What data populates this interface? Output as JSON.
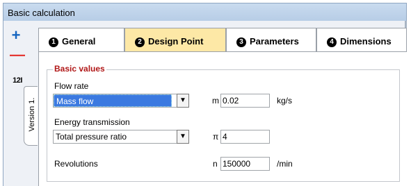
{
  "window": {
    "title": "Basic calculation"
  },
  "toolbar": {
    "add_icon": "plus-icon",
    "add_glyph": "+",
    "remove_icon": "minus-icon",
    "remove_glyph": "—",
    "numbering_label": "12I"
  },
  "version_tab": {
    "label": "Version 1."
  },
  "tabs": [
    {
      "number": "1",
      "label": "General",
      "active": false
    },
    {
      "number": "2",
      "label": "Design Point",
      "active": true
    },
    {
      "number": "3",
      "label": "Parameters",
      "active": false
    },
    {
      "number": "4",
      "label": "Dimensions",
      "active": false
    }
  ],
  "group": {
    "legend": "Basic values"
  },
  "flow": {
    "label": "Flow rate",
    "selected": "Mass flow",
    "symbol": "m",
    "value": "0.02",
    "unit": "kg/s"
  },
  "energy": {
    "label": "Energy transmission",
    "selected": "Total pressure ratio",
    "symbol": "π",
    "value": "4"
  },
  "revolutions": {
    "label": "Revolutions",
    "symbol": "n",
    "value": "150000",
    "unit": "/min"
  },
  "colors": {
    "active_tab": "#fde8a6",
    "legend": "#b01717",
    "selection": "#3b79e0",
    "add": "#1565c0",
    "remove": "#e53935"
  }
}
